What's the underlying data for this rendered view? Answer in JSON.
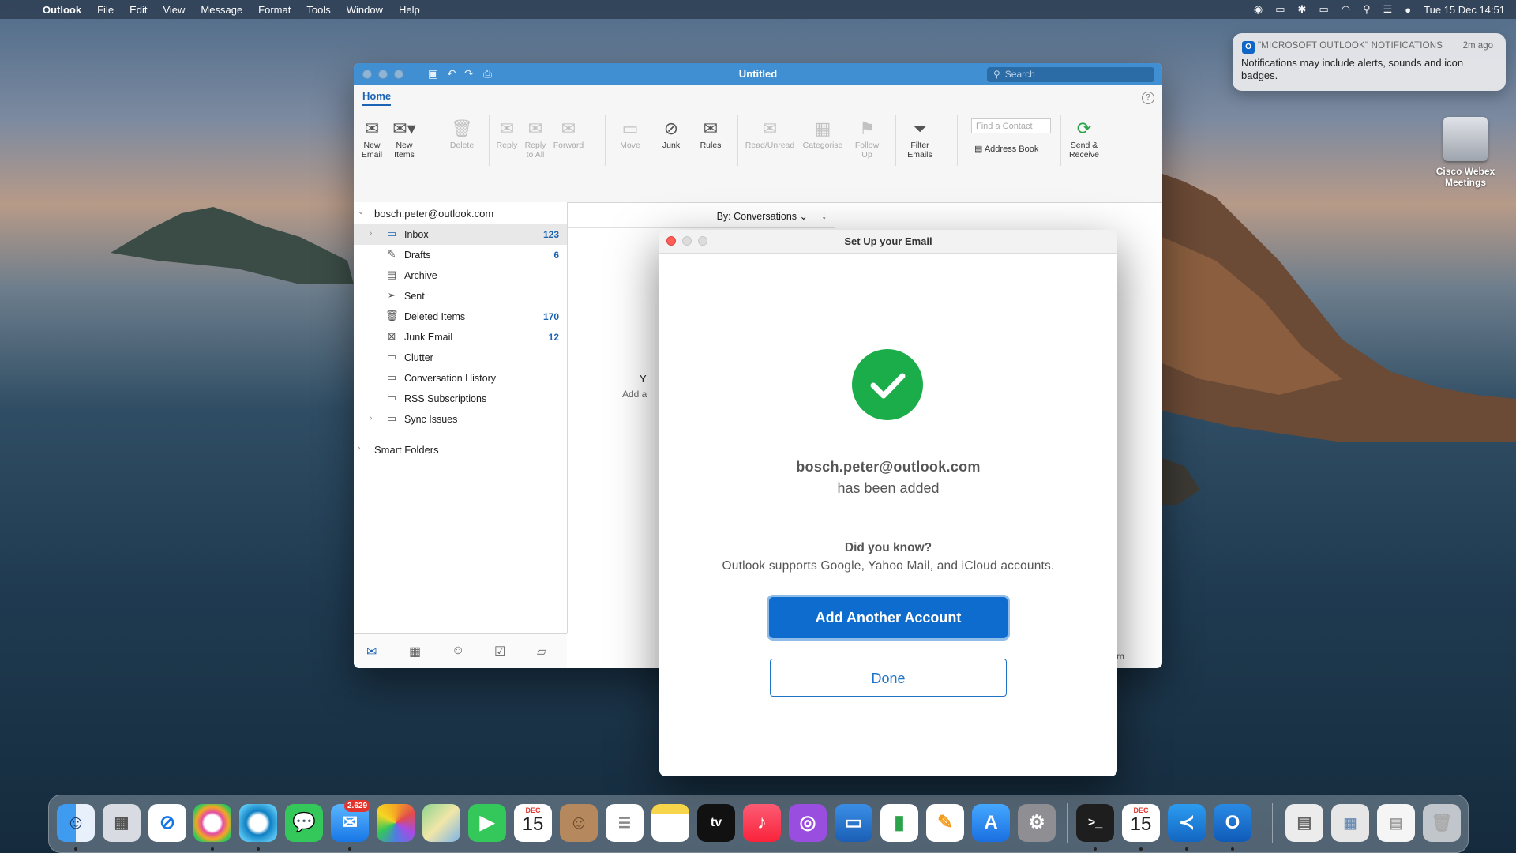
{
  "menubar": {
    "app": "Outlook",
    "items": [
      "File",
      "Edit",
      "View",
      "Message",
      "Format",
      "Tools",
      "Window",
      "Help"
    ],
    "datetime": "Tue 15 Dec  14:51"
  },
  "notification": {
    "app": "\"MICROSOFT OUTLOOK\" NOTIFICATIONS",
    "time": "2m ago",
    "message": "Notifications may include alerts, sounds and icon badges."
  },
  "desktop": {
    "icon_label": "Cisco Webex Meetings"
  },
  "window": {
    "title": "Untitled",
    "search_placeholder": "Search",
    "tab": "Home",
    "ribbon": {
      "new_email": "New Email",
      "new_items": "New Items",
      "delete": "Delete",
      "reply": "Reply",
      "reply_all": "Reply to All",
      "forward": "Forward",
      "move": "Move",
      "junk": "Junk",
      "rules": "Rules",
      "read_unread": "Read/Unread",
      "categorise": "Categorise",
      "follow_up": "Follow Up",
      "filter_emails": "Filter Emails",
      "find_contact_placeholder": "Find a Contact",
      "address_book": "Address Book",
      "send_receive": "Send & Receive"
    },
    "account": "bosch.peter@outlook.com",
    "folders": [
      {
        "name": "Inbox",
        "count": "123"
      },
      {
        "name": "Drafts",
        "count": "6"
      },
      {
        "name": "Archive",
        "count": ""
      },
      {
        "name": "Sent",
        "count": ""
      },
      {
        "name": "Deleted Items",
        "count": "170"
      },
      {
        "name": "Junk Email",
        "count": "12"
      },
      {
        "name": "Clutter",
        "count": ""
      },
      {
        "name": "Conversation History",
        "count": ""
      },
      {
        "name": "RSS Subscriptions",
        "count": ""
      },
      {
        "name": "Sync Issues",
        "count": ""
      }
    ],
    "smart_folders": "Smart Folders",
    "sort_label": "By: Conversations",
    "list_peek_1": "Y",
    "list_peek_2": "Add a",
    "status_fragment": "k.com"
  },
  "dialog": {
    "title": "Set Up your Email",
    "email": "bosch.peter@outlook.com",
    "added_text": "has been added",
    "did_you_know": "Did you know?",
    "supports_text": "Outlook supports Google, Yahoo Mail, and iCloud accounts.",
    "add_button": "Add Another Account",
    "done_button": "Done"
  },
  "dock": {
    "mail_badge": "2.629",
    "calendar_month": "DEC",
    "calendar_day": "15",
    "calendar2_month": "DEC",
    "calendar2_day": "15",
    "tv_label": "tv"
  },
  "colors": {
    "accent": "#0f6ccf",
    "title_bar": "#3f8fd2",
    "success": "#1aad4a",
    "count": "#1b64b5"
  }
}
